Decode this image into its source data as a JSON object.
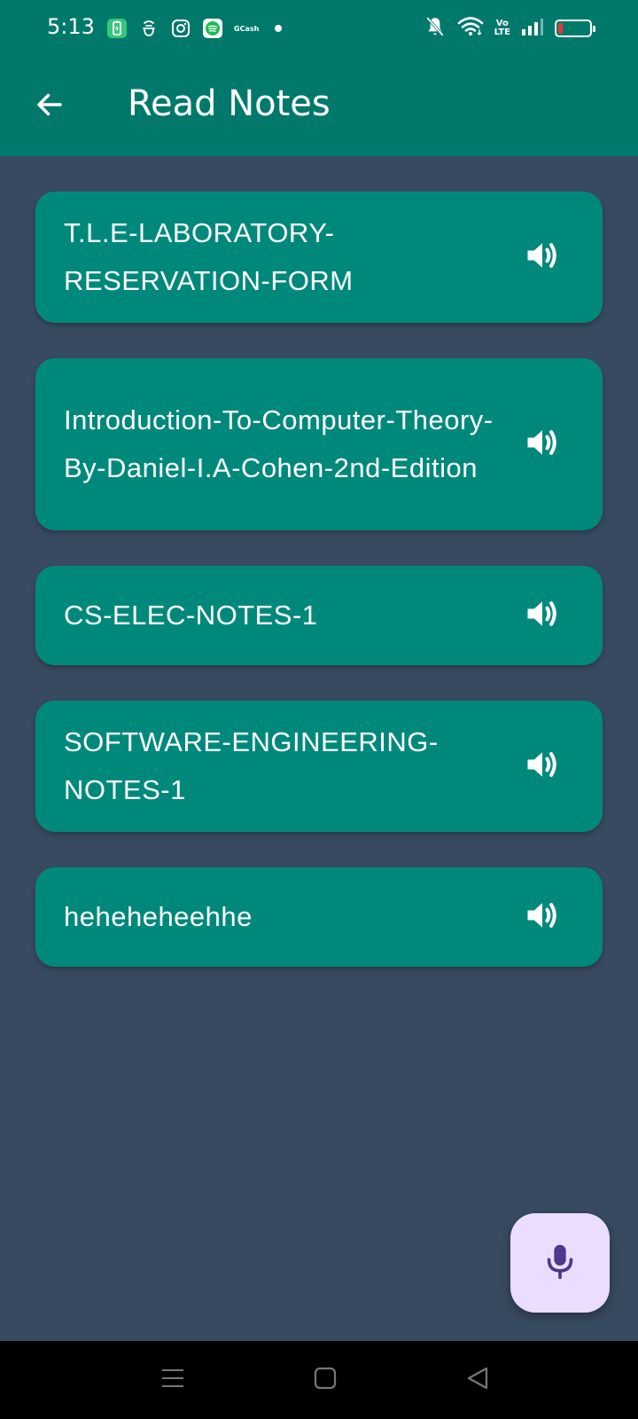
{
  "status_bar": {
    "time": "5:13",
    "gcash_label": "GCash",
    "volte_top": "Vo",
    "volte_bottom": "LTE",
    "battery_color": "#E53935"
  },
  "app_bar": {
    "title": "Read Notes",
    "back_icon": "arrow-left-icon",
    "background": "#00796B"
  },
  "notes": [
    {
      "title": "T.L.E-LABORATORY-RESERVATION-FORM",
      "icon": "speaker-icon"
    },
    {
      "title": "Introduction-To-Computer-Theory-By-Daniel-I.A-Cohen-2nd-Edition",
      "icon": "speaker-icon"
    },
    {
      "title": "CS-ELEC-NOTES-1",
      "icon": "speaker-icon"
    },
    {
      "title": "SOFTWARE-ENGINEERING-NOTES-1",
      "icon": "speaker-icon"
    },
    {
      "title": "heheheheehhe",
      "icon": "speaker-icon"
    }
  ],
  "fab": {
    "icon": "microphone-icon",
    "background": "#EADDFF",
    "icon_color": "#4F378B"
  },
  "colors": {
    "card": "#00897B",
    "page_bg": "#384A5F"
  }
}
